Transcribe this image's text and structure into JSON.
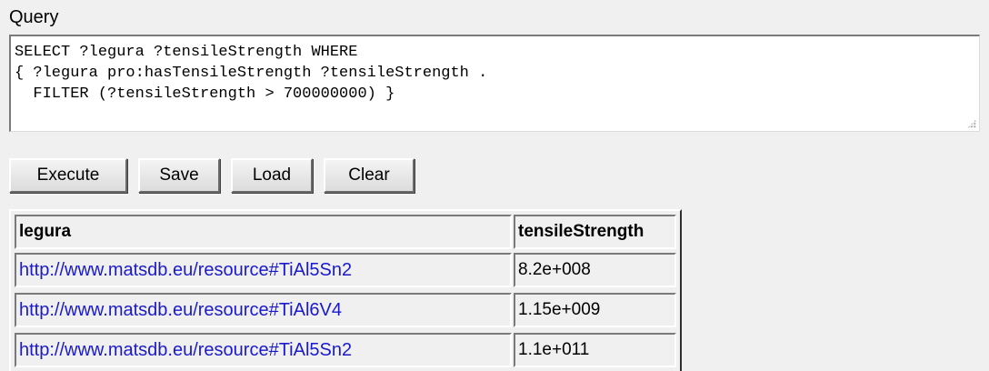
{
  "query": {
    "label": "Query",
    "text": "SELECT ?legura ?tensileStrength WHERE\n{ ?legura pro:hasTensileStrength ?tensileStrength .\n  FILTER (?tensileStrength > 700000000) }"
  },
  "buttons": {
    "execute": "Execute",
    "save": "Save",
    "load": "Load",
    "clear": "Clear"
  },
  "results": {
    "columns": [
      "legura",
      "tensileStrength"
    ],
    "rows": [
      {
        "legura": "http://www.matsdb.eu/resource#TiAl5Sn2",
        "tensileStrength": "8.2e+008"
      },
      {
        "legura": "http://www.matsdb.eu/resource#TiAl6V4",
        "tensileStrength": "1.15e+009"
      },
      {
        "legura": "http://www.matsdb.eu/resource#TiAl5Sn2",
        "tensileStrength": "1.1e+011"
      }
    ]
  },
  "colors": {
    "background": "#f0f0f0",
    "link": "#1a1acc"
  }
}
